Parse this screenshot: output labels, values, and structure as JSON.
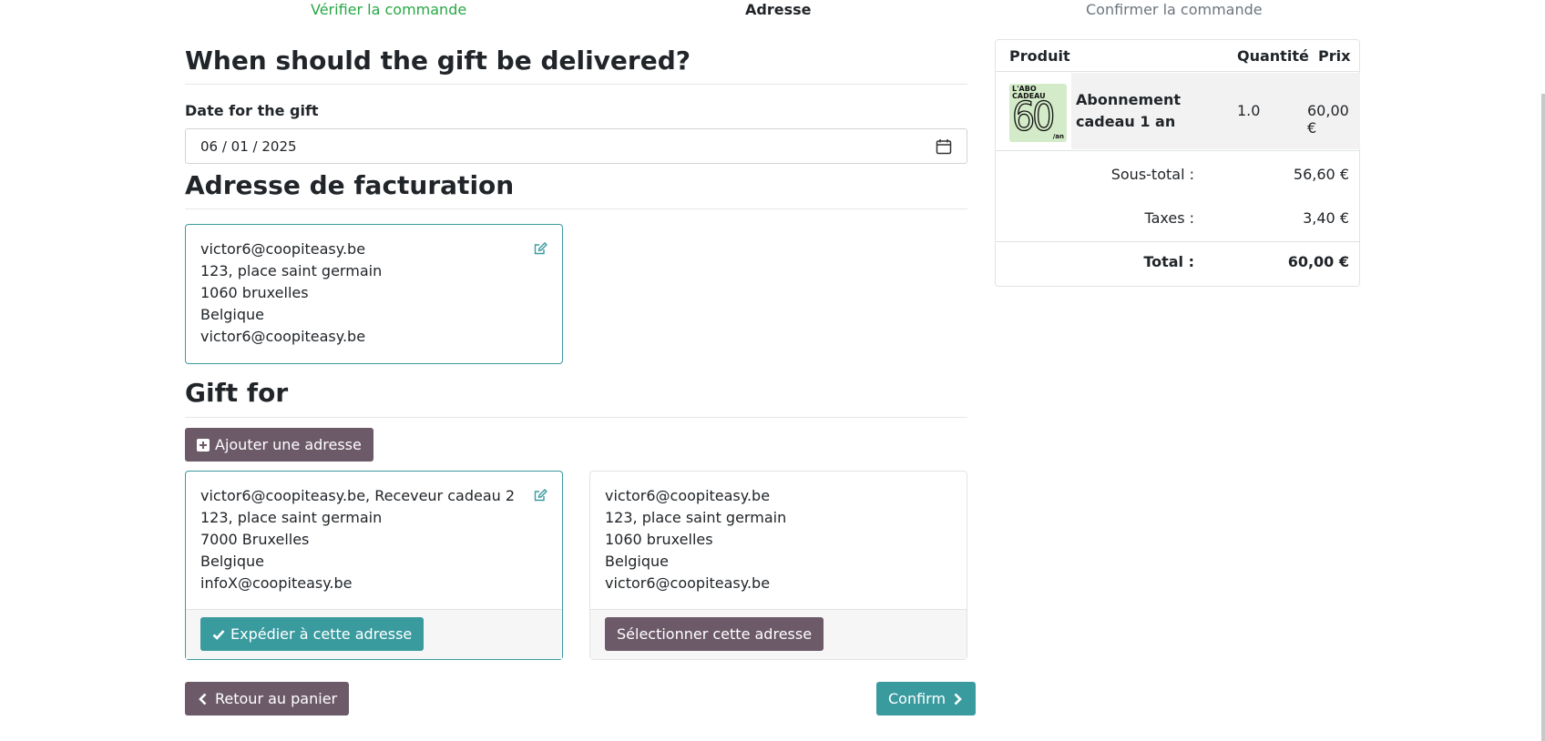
{
  "steps": {
    "step1": "Vérifier la commande",
    "step2": "Adresse",
    "step3": "Confirmer la commande"
  },
  "delivery": {
    "title": "When should the gift be delivered?",
    "date_label": "Date for the gift",
    "date_value": "06 / 01 / 2025"
  },
  "billing": {
    "title": "Adresse de facturation",
    "lines": [
      "victor6@coopiteasy.be",
      "123, place saint germain",
      "1060 bruxelles",
      "Belgique",
      "victor6@coopiteasy.be"
    ]
  },
  "gift": {
    "title": "Gift for",
    "add_button": "Ajouter une adresse",
    "cards": [
      {
        "lines": [
          "victor6@coopiteasy.be, Receveur cadeau 2",
          "123, place saint germain",
          "7000 Bruxelles",
          "Belgique",
          "infoX@coopiteasy.be"
        ],
        "button": "Expédier à cette adresse"
      },
      {
        "lines": [
          "victor6@coopiteasy.be",
          "123, place saint germain",
          "1060 bruxelles",
          "Belgique",
          "victor6@coopiteasy.be"
        ],
        "button": "Sélectionner cette adresse"
      }
    ]
  },
  "nav": {
    "back": "Retour au panier",
    "confirm": "Confirm"
  },
  "summary": {
    "col_product": "Produit",
    "col_qty": "Quantité",
    "col_price": "Prix",
    "product_name": "Abonnement cadeau 1 an",
    "product_qty": "1.0",
    "product_price": "60,00 €",
    "thumb_text1": "L'ABO",
    "thumb_text2": "CADEAU",
    "thumb_big": "60",
    "thumb_small": "/an",
    "subtotal_label": "Sous-total :",
    "subtotal_value": "56,60 €",
    "tax_label": "Taxes :",
    "tax_value": "3,40 €",
    "total_label": "Total :",
    "total_value": "60,00 €"
  },
  "colors": {
    "teal": "#3a9b9f",
    "purple": "#6d5a69",
    "green": "#28a745"
  }
}
